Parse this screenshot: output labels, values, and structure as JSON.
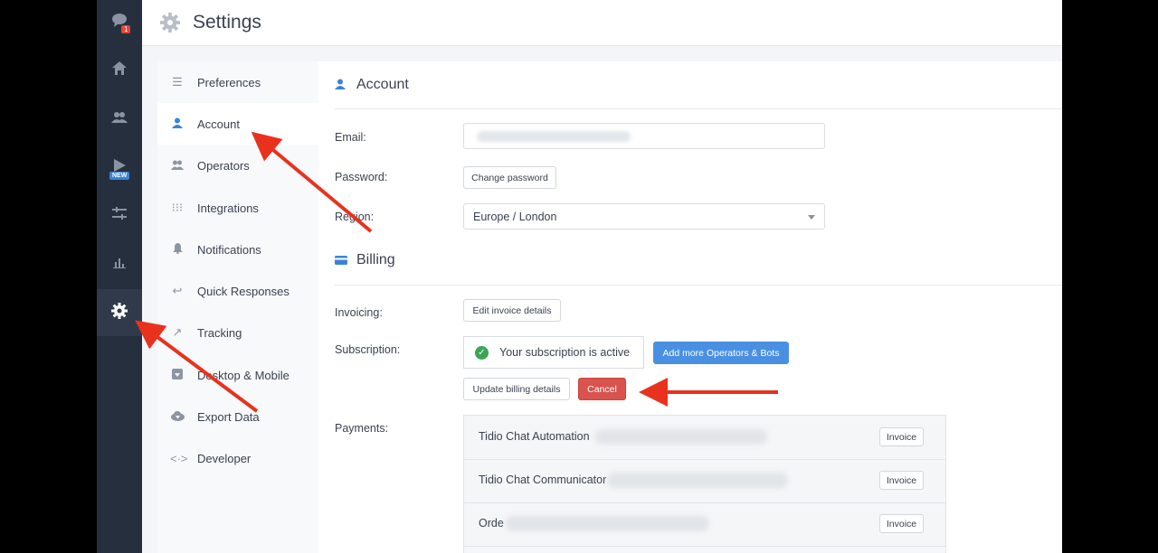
{
  "header": {
    "title": "Settings"
  },
  "rail": {
    "badge": "1",
    "new_label": "NEW"
  },
  "nav": {
    "items": [
      {
        "label": "Preferences",
        "icon": "sliders-icon"
      },
      {
        "label": "Account",
        "icon": "user-icon"
      },
      {
        "label": "Operators",
        "icon": "users-icon"
      },
      {
        "label": "Integrations",
        "icon": "grid-icon"
      },
      {
        "label": "Notifications",
        "icon": "bell-icon"
      },
      {
        "label": "Quick Responses",
        "icon": "reply-icon"
      },
      {
        "label": "Tracking",
        "icon": "trend-icon"
      },
      {
        "label": "Desktop & Mobile",
        "icon": "download-icon"
      },
      {
        "label": "Export Data",
        "icon": "cloud-download-icon"
      },
      {
        "label": "Developer",
        "icon": "code-icon"
      }
    ]
  },
  "account": {
    "title": "Account",
    "email_label": "Email:",
    "password_label": "Password:",
    "change_password": "Change password",
    "region_label": "Region:",
    "region_value": "Europe / London"
  },
  "billing": {
    "title": "Billing",
    "invoicing_label": "Invoicing:",
    "edit_invoice": "Edit invoice details",
    "subscription_label": "Subscription:",
    "subscription_status": "Your subscription is active",
    "add_more": "Add more Operators & Bots",
    "update_billing": "Update billing details",
    "cancel": "Cancel",
    "payments_label": "Payments:",
    "payments": [
      {
        "name": "Tidio Chat Automation",
        "action": "Invoice"
      },
      {
        "name": "Tidio Chat Communicator",
        "action": "Invoice"
      },
      {
        "name": "Orde",
        "action": "Invoice"
      }
    ]
  },
  "colors": {
    "accent": "#4a90e2",
    "danger": "#d9534f",
    "rail": "#262f3e",
    "annotation": "#e8321e"
  }
}
